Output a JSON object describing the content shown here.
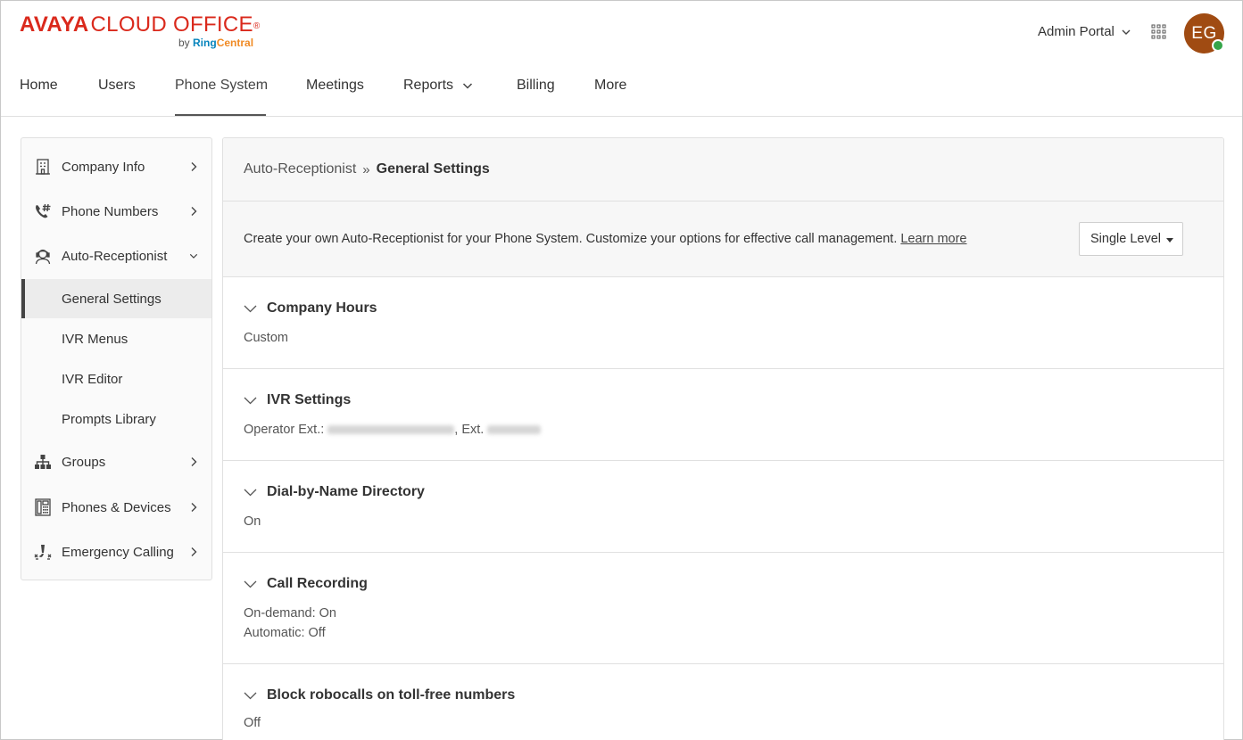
{
  "brand": {
    "avaya": "AVAYA",
    "cloud_office": "CLOUD OFFICE",
    "registered": "®",
    "by": "by ",
    "ring": "Ring",
    "central": "Central"
  },
  "header": {
    "admin_portal": "Admin Portal",
    "avatar_initials": "EG",
    "avatar_color": "#a04b12",
    "presence_color": "#35a54a"
  },
  "nav": {
    "items": [
      {
        "label": "Home"
      },
      {
        "label": "Users"
      },
      {
        "label": "Phone System",
        "active": true
      },
      {
        "label": "Meetings"
      },
      {
        "label": "Reports",
        "has_dropdown": true
      },
      {
        "label": "Billing"
      },
      {
        "label": "More"
      }
    ]
  },
  "sidebar": {
    "items": [
      {
        "label": "Company Info",
        "icon": "building-icon"
      },
      {
        "label": "Phone Numbers",
        "icon": "phone-hash-icon"
      },
      {
        "label": "Auto-Receptionist",
        "icon": "receptionist-icon",
        "expanded": true
      },
      {
        "label": "Groups",
        "icon": "org-chart-icon"
      },
      {
        "label": "Phones & Devices",
        "icon": "desk-phone-icon"
      },
      {
        "label": "Emergency Calling",
        "icon": "emergency-icon"
      }
    ],
    "sub_items": [
      {
        "label": "General Settings",
        "active": true
      },
      {
        "label": "IVR Menus"
      },
      {
        "label": "IVR Editor"
      },
      {
        "label": "Prompts Library"
      }
    ]
  },
  "main": {
    "breadcrumb": {
      "parent": "Auto-Receptionist",
      "separator": "»",
      "current": "General Settings"
    },
    "intro": {
      "text": "Create your own Auto-Receptionist for your Phone System. Customize your options for effective call management.",
      "link": "Learn more"
    },
    "level_select": {
      "value": "Single Level"
    },
    "sections": [
      {
        "title": "Company Hours",
        "lines": [
          "Custom"
        ]
      },
      {
        "title": "IVR Settings",
        "operator_prefix": "Operator Ext.:",
        "ext_prefix": ", Ext."
      },
      {
        "title": "Dial-by-Name Directory",
        "lines": [
          "On"
        ]
      },
      {
        "title": "Call Recording",
        "lines": [
          "On-demand: On",
          "Automatic: Off"
        ]
      },
      {
        "title": "Block robocalls on toll-free numbers",
        "lines": [
          "Off"
        ]
      }
    ]
  }
}
